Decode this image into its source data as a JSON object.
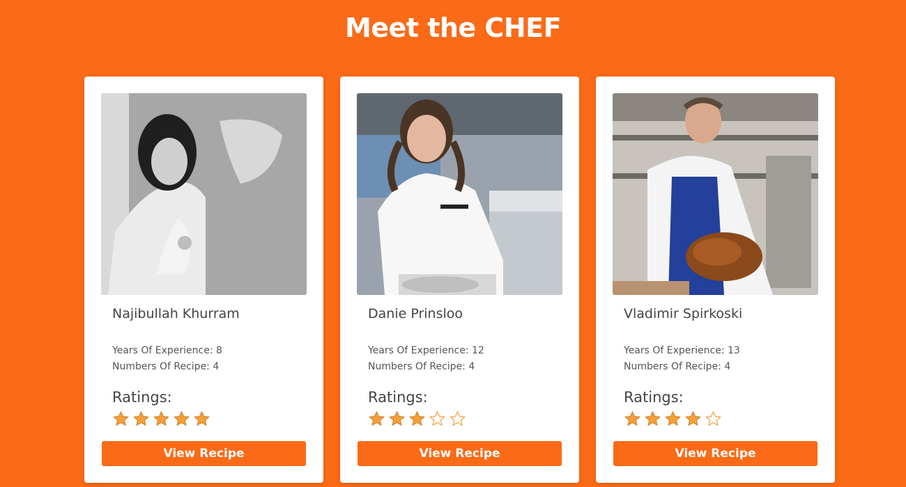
{
  "page": {
    "title": "Meet the CHEF",
    "background_color": "#fb6a17"
  },
  "chefs": [
    {
      "name": "Najibullah Khurram",
      "experience": "Years Of Experience: 8",
      "recipes": "Numbers Of Recipe: 4",
      "ratings_label": "Ratings:",
      "rating": 5,
      "rating_max": 5,
      "button_label": "View Recipe",
      "photo": "black-and-white portrait of chef in white jacket"
    },
    {
      "name": "Danie Prinsloo",
      "experience": "Years Of Experience: 12",
      "recipes": "Numbers Of Recipe: 4",
      "ratings_label": "Ratings:",
      "rating": 3,
      "rating_max": 5,
      "button_label": "View Recipe",
      "photo": "chef in white jacket with braids in kitchen"
    },
    {
      "name": "Vladimir Spirkoski",
      "experience": "Years Of Experience: 13",
      "recipes": "Numbers Of Recipe: 4",
      "ratings_label": "Ratings:",
      "rating": 4,
      "rating_max": 5,
      "button_label": "View Recipe",
      "photo": "chef in blue apron carving roast turkey"
    }
  ],
  "colors": {
    "accent": "#fb6a17",
    "star_filled": "#f4a03a",
    "star_empty_outline": "#f4a03a"
  },
  "icons": {
    "star_filled": "star-filled-icon",
    "star_empty": "star-outline-icon"
  }
}
